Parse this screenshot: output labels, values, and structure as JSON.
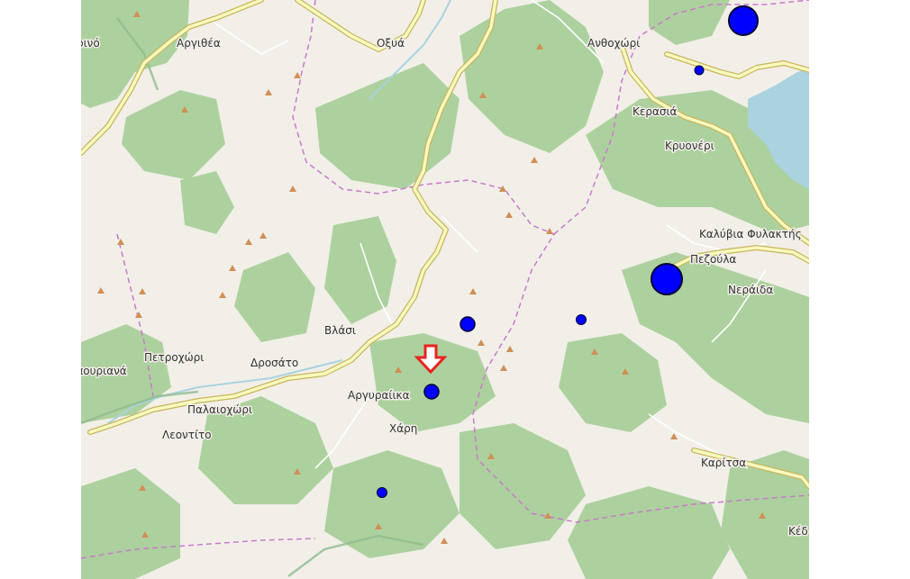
{
  "map": {
    "colors": {
      "land": "#f2efe9",
      "forest": "#add19e",
      "water": "#aad3df",
      "road_casing": "#c9b55b",
      "road_fill": "#f7fabf",
      "track": "#ffffff",
      "boundary": "#c77bc9",
      "protected_area": "#8fbc8f",
      "peak": "#d08f55",
      "marker_fill": "#0000ff",
      "marker_stroke": "#000033",
      "arrow": "#e8231f"
    },
    "icons": {
      "peak": "triangle-peak-icon",
      "event": "circle-marker-icon",
      "pointer": "down-arrow-icon"
    },
    "places": [
      {
        "name": "ρινό"
      },
      {
        "name": "Αργιθέα"
      },
      {
        "name": "Οξυά"
      },
      {
        "name": "Ανθοχώρι"
      },
      {
        "name": "Κερασιά"
      },
      {
        "name": "Κρυονέρι"
      },
      {
        "name": "Καλύβια Φυλακτής"
      },
      {
        "name": "Πεζούλα"
      },
      {
        "name": "Νεράιδα"
      },
      {
        "name": "Βλάσι"
      },
      {
        "name": "Πετροχώρι"
      },
      {
        "name": "Δροσάτο"
      },
      {
        "name": "πουριανά"
      },
      {
        "name": "Αργυραίικα"
      },
      {
        "name": "Παλαιοχώρι"
      },
      {
        "name": "Χάρη"
      },
      {
        "name": "Λεοντίτο"
      },
      {
        "name": "Καρίτσα"
      },
      {
        "name": "Κέδ"
      }
    ],
    "markers": [
      {
        "id": "large-top-right",
        "size": "large"
      },
      {
        "id": "small-anthochori",
        "size": "small"
      },
      {
        "id": "large-pezoula",
        "size": "large"
      },
      {
        "id": "medium-center",
        "size": "medium"
      },
      {
        "id": "small-east",
        "size": "small"
      },
      {
        "id": "medium-selected",
        "size": "medium"
      },
      {
        "id": "small-south",
        "size": "small"
      }
    ]
  }
}
